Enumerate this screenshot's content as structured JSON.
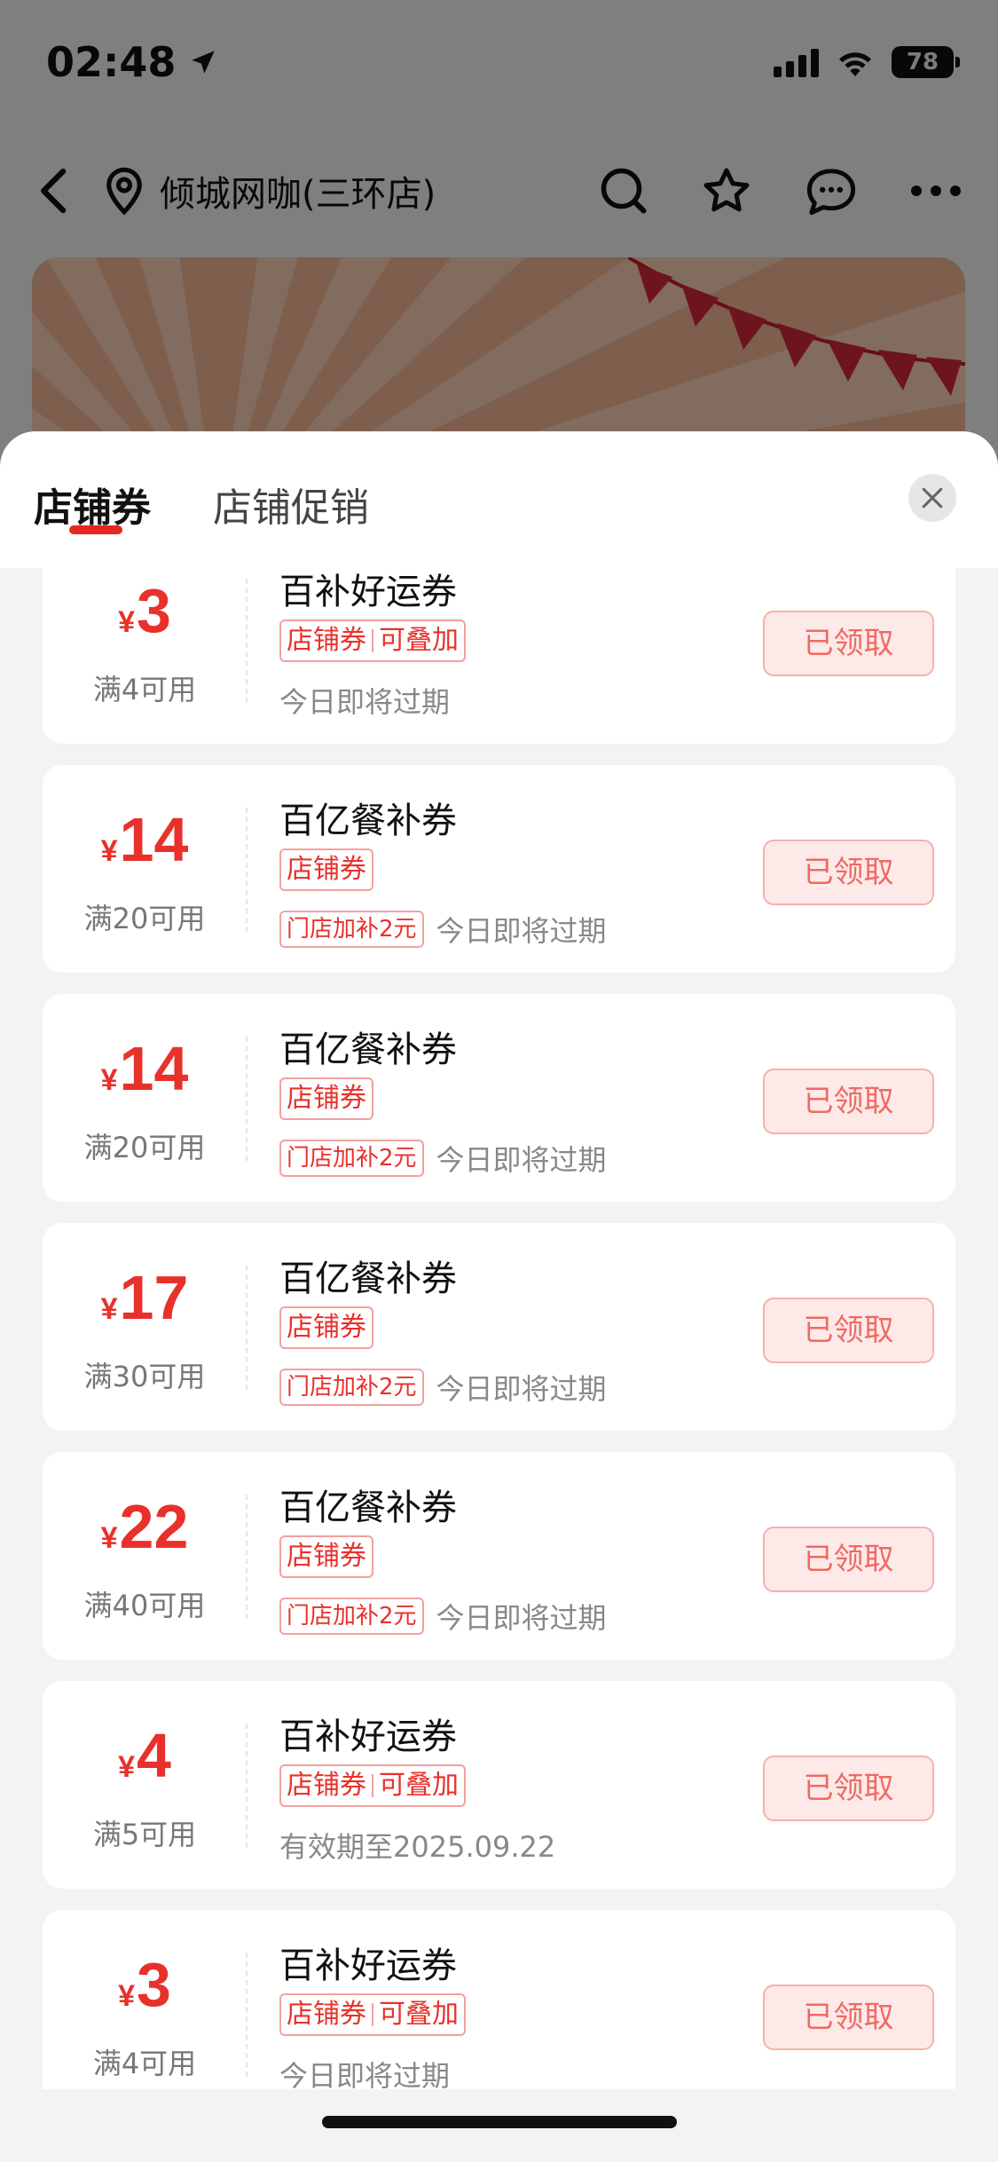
{
  "status_bar": {
    "time": "02:48",
    "battery": "78"
  },
  "nav": {
    "title": "倾城网咖(三环店)"
  },
  "sheet": {
    "tabs": [
      {
        "label": "店铺券",
        "active": true
      },
      {
        "label": "店铺促销",
        "active": false
      }
    ]
  },
  "coupons": [
    {
      "currency": "¥",
      "amount": "3",
      "condition": "满4可用",
      "title": "百补好运券",
      "tags": [
        "店铺券",
        "可叠加"
      ],
      "badge": "",
      "expiry": "今日即将过期",
      "button": "已领取"
    },
    {
      "currency": "¥",
      "amount": "14",
      "condition": "满20可用",
      "title": "百亿餐补券",
      "tags": [
        "店铺券"
      ],
      "badge": "门店加补2元",
      "expiry": "今日即将过期",
      "button": "已领取"
    },
    {
      "currency": "¥",
      "amount": "14",
      "condition": "满20可用",
      "title": "百亿餐补券",
      "tags": [
        "店铺券"
      ],
      "badge": "门店加补2元",
      "expiry": "今日即将过期",
      "button": "已领取"
    },
    {
      "currency": "¥",
      "amount": "17",
      "condition": "满30可用",
      "title": "百亿餐补券",
      "tags": [
        "店铺券"
      ],
      "badge": "门店加补2元",
      "expiry": "今日即将过期",
      "button": "已领取"
    },
    {
      "currency": "¥",
      "amount": "22",
      "condition": "满40可用",
      "title": "百亿餐补券",
      "tags": [
        "店铺券"
      ],
      "badge": "门店加补2元",
      "expiry": "今日即将过期",
      "button": "已领取"
    },
    {
      "currency": "¥",
      "amount": "4",
      "condition": "满5可用",
      "title": "百补好运券",
      "tags": [
        "店铺券",
        "可叠加"
      ],
      "badge": "",
      "expiry": "有效期至2025.09.22",
      "button": "已领取"
    },
    {
      "currency": "¥",
      "amount": "3",
      "condition": "满4可用",
      "title": "百补好运券",
      "tags": [
        "店铺券",
        "可叠加"
      ],
      "badge": "",
      "expiry": "今日即将过期",
      "button": "已领取"
    }
  ],
  "colors": {
    "accent": "#e8312b",
    "claimed_bg": "#fde9e8",
    "sheet_bg": "#f2f3f5"
  },
  "icons": [
    "location-arrow-icon",
    "signal-icon",
    "wifi-icon",
    "battery-icon",
    "back-icon",
    "location-pin-icon",
    "search-icon",
    "star-icon",
    "chat-icon",
    "more-icon",
    "close-icon"
  ]
}
